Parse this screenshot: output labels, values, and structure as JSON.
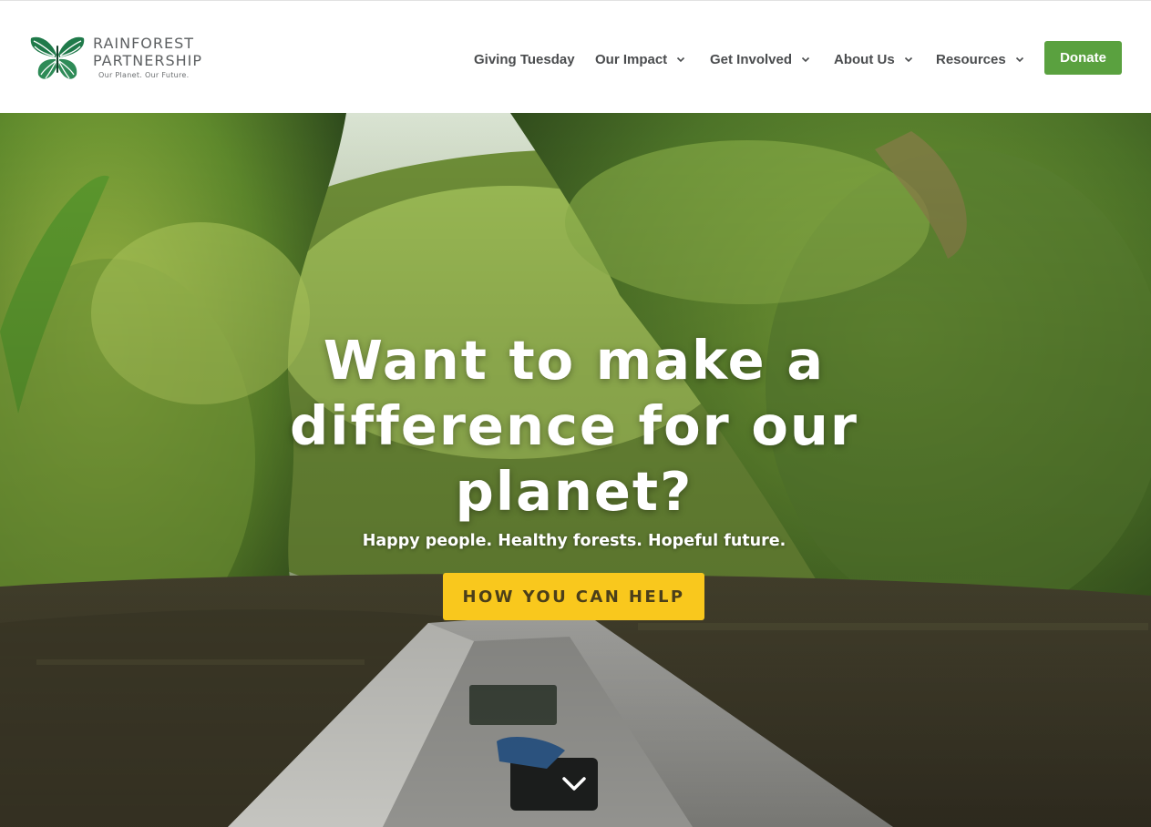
{
  "header": {
    "logo": {
      "line1": "RAINFOREST",
      "line2": "PARTNERSHIP",
      "tagline": "Our Planet. Our Future."
    },
    "nav": [
      {
        "label": "Giving Tuesday",
        "has_dropdown": false
      },
      {
        "label": "Our Impact",
        "has_dropdown": true
      },
      {
        "label": "Get Involved",
        "has_dropdown": true
      },
      {
        "label": "About Us",
        "has_dropdown": true
      },
      {
        "label": "Resources",
        "has_dropdown": true
      }
    ],
    "donate_label": "Donate"
  },
  "hero": {
    "headline_lines": [
      "Want to make a",
      "difference for our",
      "planet?"
    ],
    "subheadline": "Happy people. Healthy forests. Hopeful future.",
    "cta_label": "HOW YOU CAN HELP",
    "scroll_icon": "chevron-down-icon"
  },
  "colors": {
    "brand_green": "#5aa13f",
    "logo_green": "#2e8b57",
    "cta_yellow": "#f9c81d",
    "nav_text": "#4a4c4e"
  }
}
